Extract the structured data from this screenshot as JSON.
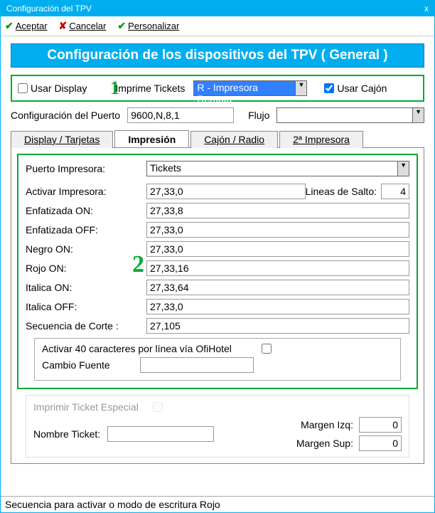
{
  "window": {
    "title": "Configuración del TPV",
    "close": "x"
  },
  "toolbar": {
    "accept": "Aceptar",
    "cancel": "Cancelar",
    "customize": "Personalizar"
  },
  "banner": "Configuración de los dispositivos del TPV ( General )",
  "annotations": {
    "one": "1",
    "two": "2"
  },
  "topbox": {
    "use_display": "Usar Display",
    "print_tickets": "Imprime Tickets",
    "printer_select": "R - Impresora Remota",
    "use_drawer": "Usar Cajón"
  },
  "port_row": {
    "label": "Configuración del Puerto",
    "value": "9600,N,8,1",
    "flow_label": "Flujo",
    "flow_value": ""
  },
  "tabs": {
    "t0": "Display / Tarjetas",
    "t1": "Impresión",
    "t2": "Cajón / Radio",
    "t3": "2ª Impresora"
  },
  "impresion": {
    "puerto_label": "Puerto Impresora:",
    "puerto_value": "Tickets",
    "activar_label": "Activar Impresora:",
    "activar_value": "27,33,0",
    "lineas_label": "Lineas de Salto:",
    "lineas_value": "4",
    "enf_on_label": "Enfatizada ON:",
    "enf_on_value": "27,33,8",
    "enf_off_label": "Enfatizada OFF:",
    "enf_off_value": "27,33,0",
    "negro_label": "Negro ON:",
    "negro_value": "27,33,0",
    "rojo_label": "Rojo ON:",
    "rojo_value": "27,33,16",
    "ital_on_label": "Italica ON:",
    "ital_on_value": "27,33,64",
    "ital_off_label": "Italica OFF:",
    "ital_off_value": "27,33,0",
    "corte_label": "Secuencia de Corte :",
    "corte_value": "27,105",
    "activar40": "Activar 40 caracteres por línea vía OfiHotel",
    "cambio_fuente": "Cambio Fuente",
    "cambio_fuente_value": ""
  },
  "special": {
    "label": "Imprimir Ticket Especial",
    "nombre_label": "Nombre Ticket:",
    "nombre_value": "",
    "margen_izq_label": "Margen Izq:",
    "margen_izq_value": "0",
    "margen_sup_label": "Margen Sup:",
    "margen_sup_value": "0"
  },
  "status": "Secuencia para activar o modo de escritura Rojo"
}
